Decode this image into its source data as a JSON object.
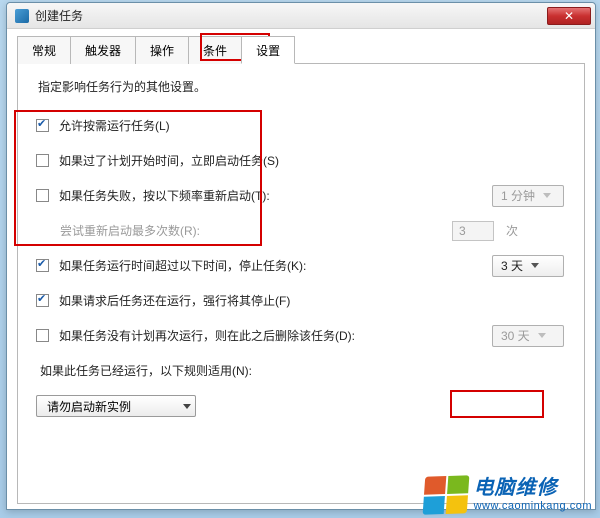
{
  "window": {
    "title": "创建任务"
  },
  "tabs": {
    "items": [
      {
        "label": "常规"
      },
      {
        "label": "触发器"
      },
      {
        "label": "操作"
      },
      {
        "label": "条件"
      },
      {
        "label": "设置"
      }
    ],
    "active_index": 4
  },
  "settings": {
    "description": "指定影响任务行为的其他设置。",
    "opts": {
      "allow_on_demand": {
        "label": "允许按需运行任务(L)",
        "checked": true
      },
      "run_if_missed": {
        "label": "如果过了计划开始时间，立即启动任务(S)",
        "checked": false
      },
      "restart_on_fail": {
        "label": "如果任务失败，按以下频率重新启动(T):",
        "checked": false,
        "interval": "1 分钟"
      },
      "retry_count": {
        "label": "尝试重新启动最多次数(R):",
        "value": "3",
        "unit": "次"
      },
      "stop_after": {
        "label": "如果任务运行时间超过以下时间，停止任务(K):",
        "checked": true,
        "duration": "3 天"
      },
      "force_stop": {
        "label": "如果请求后任务还在运行，强行将其停止(F)",
        "checked": true
      },
      "delete_after": {
        "label": "如果任务没有计划再次运行，则在此之后删除该任务(D):",
        "checked": false,
        "duration": "30 天"
      }
    },
    "rule": {
      "label": "如果此任务已经运行，以下规则适用(N):",
      "selected": "请勿启动新实例"
    }
  },
  "watermark": {
    "line1": "电脑维修",
    "line2": "www.caominkang.com"
  }
}
